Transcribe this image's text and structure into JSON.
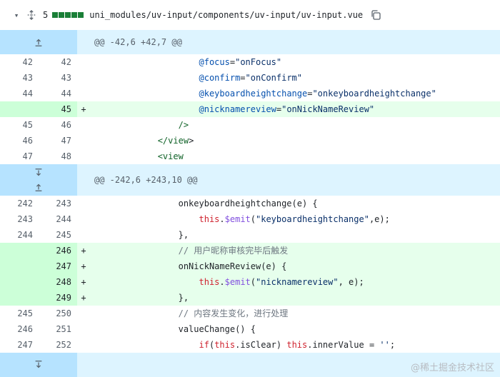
{
  "file": {
    "change_count": "5",
    "path": "uni_modules/uv-input/components/uv-input/uv-input.vue",
    "diffstat_color": "#1a7f37"
  },
  "hunks": [
    {
      "header": "@@ -42,6 +42,7 @@"
    },
    {
      "header": "@@ -242,6 +243,10 @@"
    }
  ],
  "lines_a": [
    {
      "old": "42",
      "new": "42",
      "marker": "",
      "code": "                    @focus=\"onFocus\""
    },
    {
      "old": "43",
      "new": "43",
      "marker": "",
      "code": "                    @confirm=\"onConfirm\""
    },
    {
      "old": "44",
      "new": "44",
      "marker": "",
      "code": "                    @keyboardheightchange=\"onkeyboardheightchange\""
    },
    {
      "old": "",
      "new": "45",
      "marker": "+",
      "code": "                    @nicknamereview=\"onNickNameReview\""
    },
    {
      "old": "45",
      "new": "46",
      "marker": "",
      "code": "                />"
    },
    {
      "old": "46",
      "new": "47",
      "marker": "",
      "code": "            </view>"
    },
    {
      "old": "47",
      "new": "48",
      "marker": "",
      "code": "            <view"
    }
  ],
  "lines_b": [
    {
      "old": "242",
      "new": "243",
      "marker": "",
      "code": "                onkeyboardheightchange(e) {"
    },
    {
      "old": "243",
      "new": "244",
      "marker": "",
      "code": "                    this.$emit(\"keyboardheightchange\",e);"
    },
    {
      "old": "244",
      "new": "245",
      "marker": "",
      "code": "                },"
    },
    {
      "old": "",
      "new": "246",
      "marker": "+",
      "code": "                // 用户昵称审核完毕后触发"
    },
    {
      "old": "",
      "new": "247",
      "marker": "+",
      "code": "                onNickNameReview(e) {"
    },
    {
      "old": "",
      "new": "248",
      "marker": "+",
      "code": "                    this.$emit(\"nicknamereview\", e);"
    },
    {
      "old": "",
      "new": "249",
      "marker": "+",
      "code": "                },"
    },
    {
      "old": "245",
      "new": "250",
      "marker": "",
      "code": "                // 内容发生变化，进行处理"
    },
    {
      "old": "246",
      "new": "251",
      "marker": "",
      "code": "                valueChange() {"
    },
    {
      "old": "247",
      "new": "252",
      "marker": "",
      "code": "                    if(this.isClear) this.innerValue = '';"
    }
  ],
  "watermark": "@稀土掘金技术社区"
}
